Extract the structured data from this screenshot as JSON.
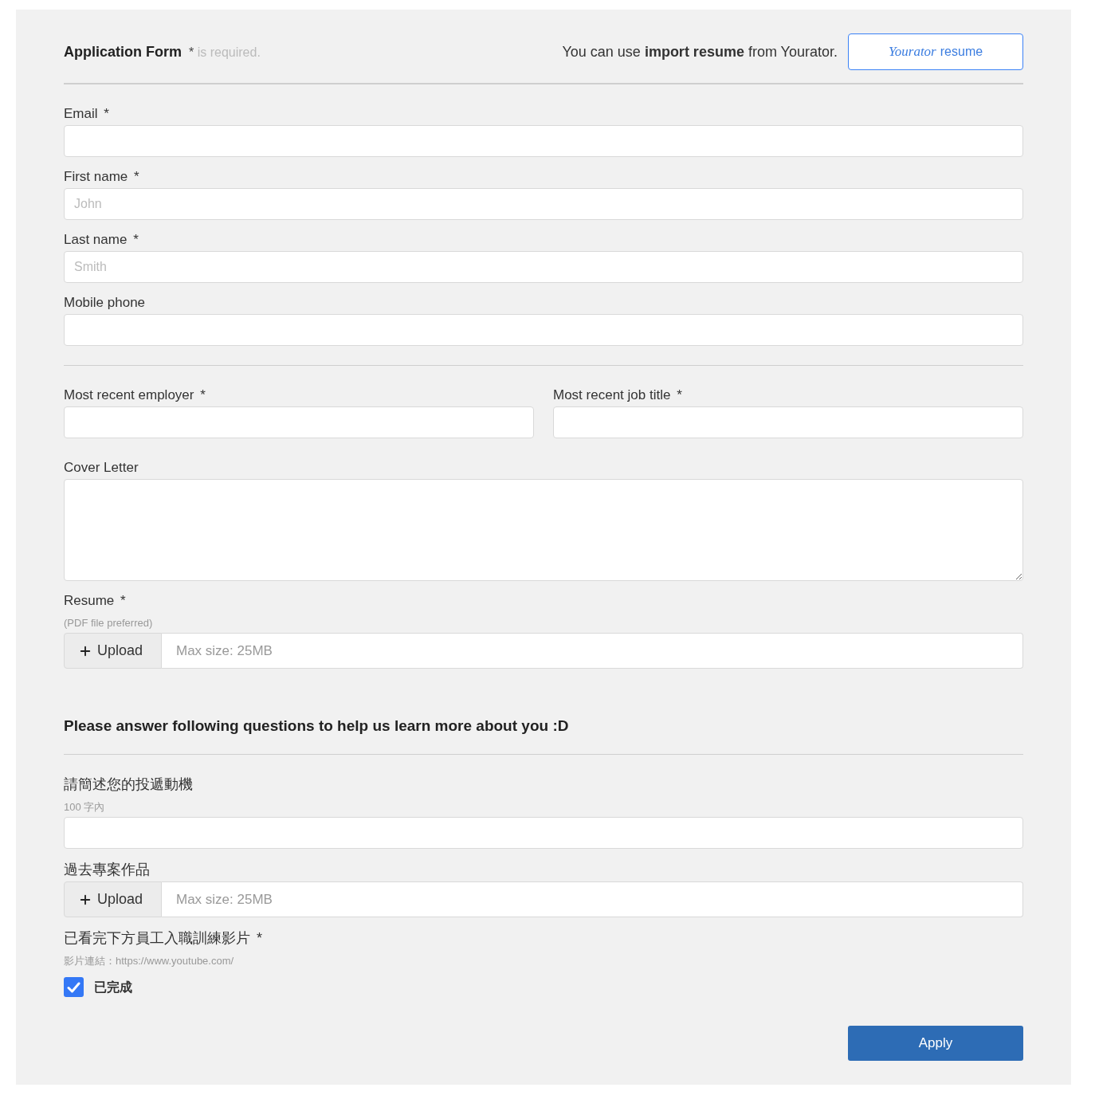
{
  "header": {
    "title": "Application Form",
    "required_mark": "*",
    "required_note": "is required.",
    "import_hint": "You can use **import resume** from Yourator.",
    "import_button": {
      "logo": "Yourator",
      "label": "resume"
    }
  },
  "contact_fields": [
    {
      "label": "Email",
      "required_mark": "*"
    },
    {
      "label": "First name",
      "required_mark": "*",
      "placeholder": "John"
    },
    {
      "label": "Last name",
      "required_mark": "*",
      "placeholder": "Smith"
    },
    {
      "label": "Mobile phone"
    }
  ],
  "job_fields": [
    {
      "label": "Most recent employer",
      "required_mark": "*"
    },
    {
      "label": "Most recent job title",
      "required_mark": "*"
    }
  ],
  "cover_letter": {
    "label": "Cover Letter"
  },
  "resume": {
    "label": "Resume",
    "required_mark": "*",
    "hint": "(PDF file preferred)",
    "button": "Upload",
    "placeholder": "Max size: 25MB"
  },
  "questions": {
    "heading": "Please answer following questions to help us learn more about you :D",
    "items": [
      {
        "kind": "text",
        "label": "請簡述您的投遞動機",
        "hint": "100 字內"
      },
      {
        "kind": "upload",
        "label": "過去專案作品",
        "button": "Upload",
        "placeholder": "Max size: 25MB"
      },
      {
        "kind": "checkbox",
        "label": "已看完下方員工入職訓練影片",
        "required_mark": "*",
        "hint": "影片連結：https://www.youtube.com/",
        "option": "已完成",
        "checked": true
      }
    ]
  },
  "apply_button": "Apply"
}
